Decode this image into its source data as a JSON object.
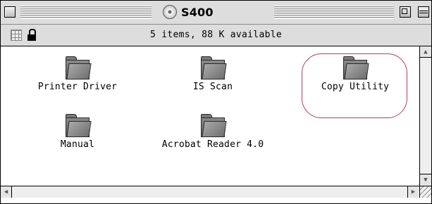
{
  "window": {
    "title": "S400",
    "title_icon": "cd-icon"
  },
  "info_bar": {
    "status": "5 items, 88 K available",
    "icons": [
      "grid-icon",
      "lock-icon"
    ]
  },
  "items": [
    {
      "label": "Printer Driver",
      "icon": "folder-icon"
    },
    {
      "label": "IS Scan",
      "icon": "folder-icon"
    },
    {
      "label": "Copy Utility",
      "icon": "folder-icon",
      "highlighted": true
    },
    {
      "label": "Manual",
      "icon": "folder-icon"
    },
    {
      "label": "Acrobat Reader 4.0",
      "icon": "folder-icon"
    }
  ],
  "scrollbars": {
    "up": "▲",
    "down": "▼",
    "left": "◀",
    "right": "▶"
  },
  "colors": {
    "highlight_ring": "#b0405a",
    "chrome": "#dddddd"
  }
}
